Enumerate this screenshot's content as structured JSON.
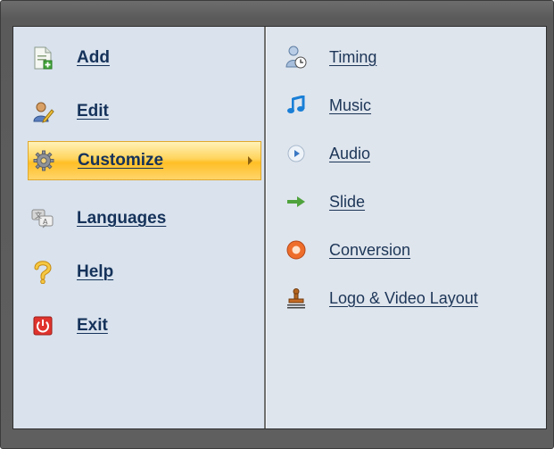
{
  "menu": {
    "left_items": [
      {
        "label": "Add",
        "icon": "document-add-icon"
      },
      {
        "label": "Edit",
        "icon": "user-edit-icon"
      },
      {
        "label": "Customize",
        "icon": "gear-icon",
        "active": true
      },
      {
        "label": "Languages",
        "icon": "languages-icon"
      },
      {
        "label": "Help",
        "icon": "question-icon"
      },
      {
        "label": "Exit",
        "icon": "power-icon"
      }
    ],
    "right_items": [
      {
        "label": "Timing",
        "icon": "user-clock-icon"
      },
      {
        "label": "Music",
        "icon": "music-note-icon"
      },
      {
        "label": "Audio",
        "icon": "audio-play-icon"
      },
      {
        "label": "Slide",
        "icon": "arrow-right-icon"
      },
      {
        "label": "Conversion",
        "icon": "conversion-icon"
      },
      {
        "label": "Logo & Video Layout",
        "icon": "stamp-icon"
      }
    ]
  },
  "colors": {
    "frame": "#5f5f5f",
    "left_panel": "#d9e2ed",
    "right_panel": "#dfe5ed",
    "active_highlight": "#ffc83a",
    "label_text": "#15325a"
  }
}
